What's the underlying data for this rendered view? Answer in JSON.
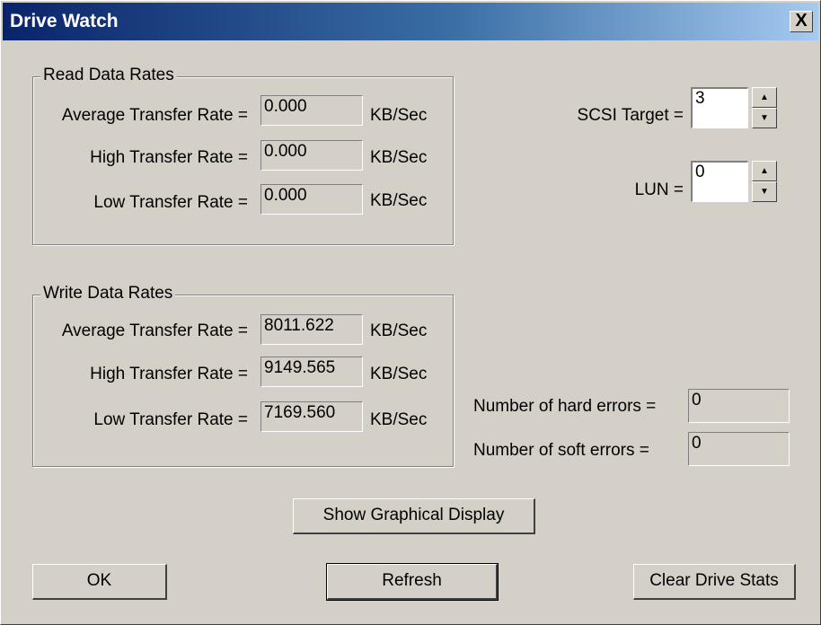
{
  "window": {
    "title": "Drive Watch",
    "close_label": "X"
  },
  "read_group": {
    "title": "Read Data Rates",
    "rows": [
      {
        "label": "Average Transfer Rate =",
        "value": "0.000",
        "unit": "KB/Sec"
      },
      {
        "label": "High Transfer Rate =",
        "value": "0.000",
        "unit": "KB/Sec"
      },
      {
        "label": "Low Transfer Rate =",
        "value": "0.000",
        "unit": "KB/Sec"
      }
    ]
  },
  "write_group": {
    "title": "Write Data Rates",
    "rows": [
      {
        "label": "Average Transfer Rate =",
        "value": "8011.622",
        "unit": "KB/Sec"
      },
      {
        "label": "High Transfer Rate =",
        "value": "9149.565",
        "unit": "KB/Sec"
      },
      {
        "label": "Low Transfer Rate =",
        "value": "7169.560",
        "unit": "KB/Sec"
      }
    ]
  },
  "scsi_target": {
    "label": "SCSI Target =",
    "value": "3"
  },
  "lun": {
    "label": "LUN =",
    "value": "0"
  },
  "errors": {
    "hard_label": "Number of hard errors =",
    "hard_value": "0",
    "soft_label": "Number of soft errors =",
    "soft_value": "0"
  },
  "buttons": {
    "graphical": "Show Graphical Display",
    "ok": "OK",
    "refresh": "Refresh",
    "clear": "Clear Drive Stats"
  }
}
